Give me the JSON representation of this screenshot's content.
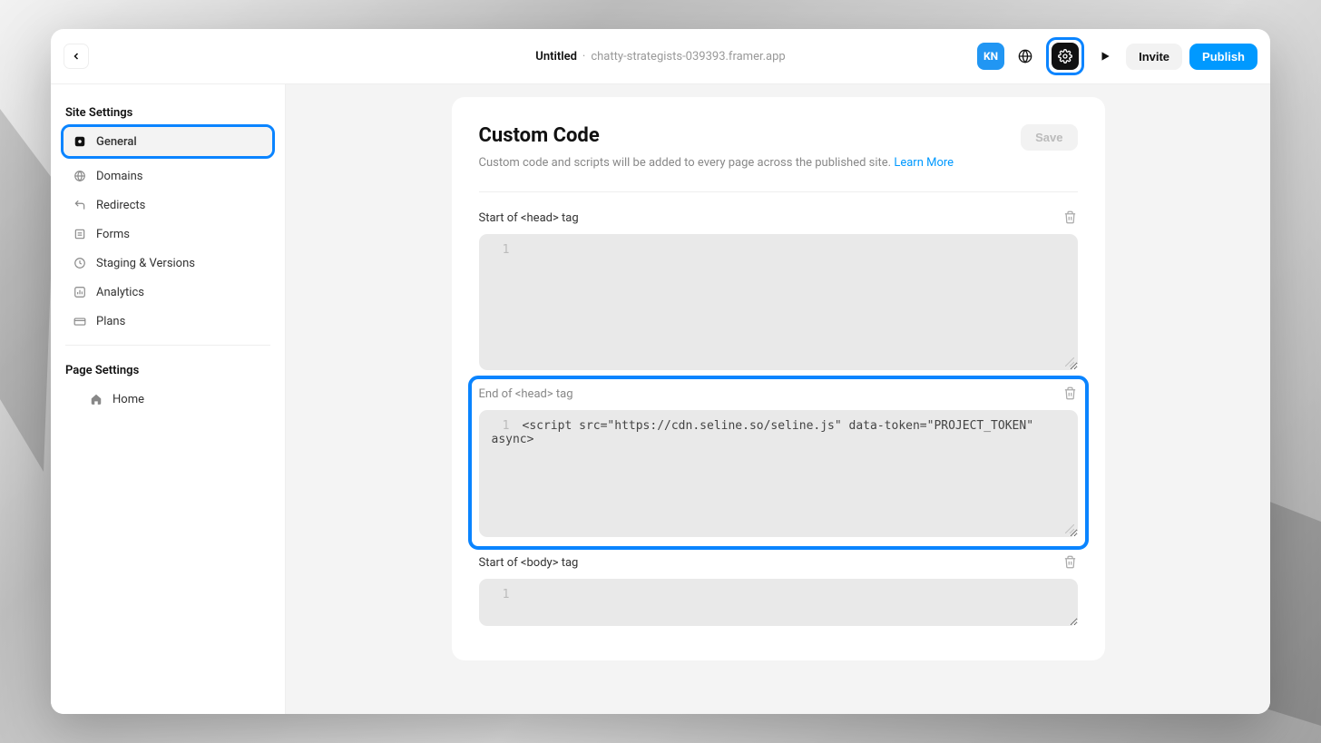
{
  "header": {
    "project_name": "Untitled",
    "separator": "·",
    "domain": "chatty-strategists-039393.framer.app",
    "avatar_initials": "KN",
    "invite_label": "Invite",
    "publish_label": "Publish"
  },
  "sidebar": {
    "site_settings_heading": "Site Settings",
    "items": [
      {
        "label": "General",
        "active": true
      },
      {
        "label": "Domains",
        "active": false
      },
      {
        "label": "Redirects",
        "active": false
      },
      {
        "label": "Forms",
        "active": false
      },
      {
        "label": "Staging & Versions",
        "active": false
      },
      {
        "label": "Analytics",
        "active": false
      },
      {
        "label": "Plans",
        "active": false
      }
    ],
    "page_settings_heading": "Page Settings",
    "page_items": [
      {
        "label": "Home"
      }
    ]
  },
  "panel": {
    "title": "Custom Code",
    "subtitle": "Custom code and scripts will be added to every page across the published site.",
    "learn_more": "Learn More",
    "save_label": "Save",
    "sections": [
      {
        "label": "Start of <head> tag",
        "line_no": "1",
        "content": ""
      },
      {
        "label": "End of <head> tag",
        "line_no": "1",
        "content": "<script src=\"https://cdn.seline.so/seline.js\" data-token=\"PROJECT_TOKEN\" async>"
      },
      {
        "label": "Start of <body> tag",
        "line_no": "1",
        "content": ""
      }
    ]
  }
}
